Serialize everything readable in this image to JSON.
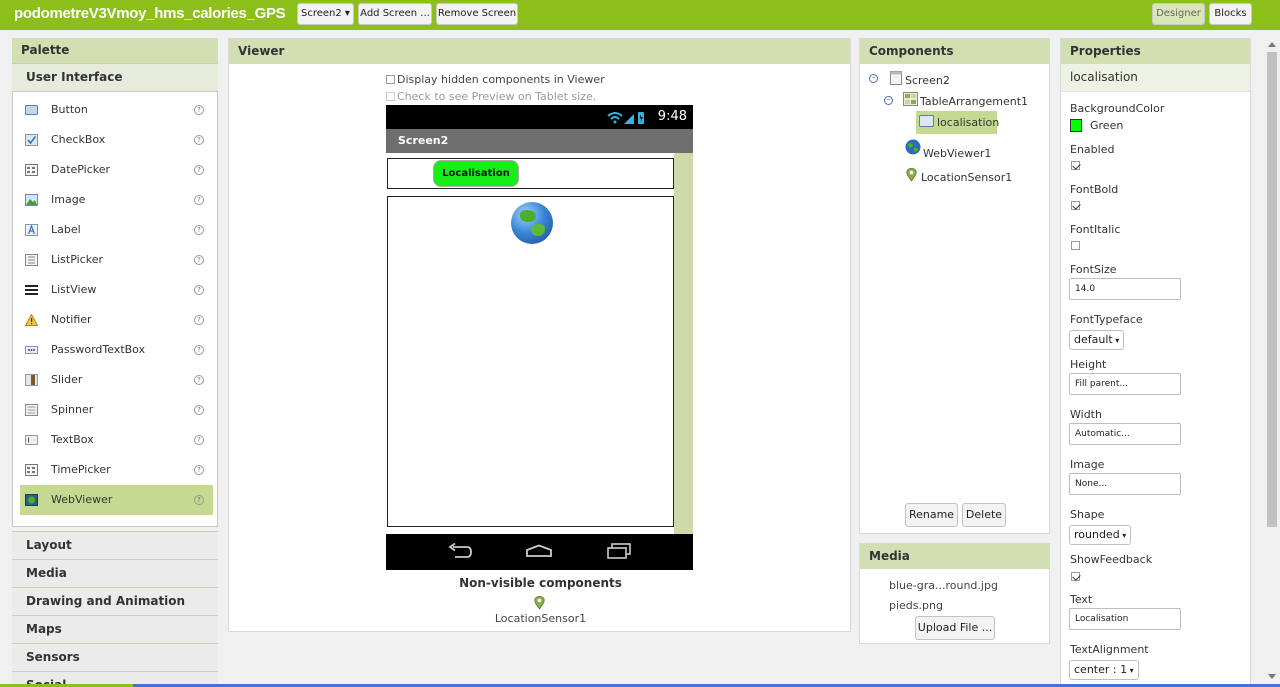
{
  "topbar": {
    "project_title": "podometreV3Vmoy_hms_calories_GPS",
    "screen_select": "Screen2 ▾",
    "add_screen": "Add Screen ...",
    "remove_screen": "Remove Screen",
    "designer": "Designer",
    "blocks": "Blocks"
  },
  "palette": {
    "title": "Palette",
    "open_category": "User Interface",
    "items": [
      {
        "label": "Button",
        "icon": "button-icon"
      },
      {
        "label": "CheckBox",
        "icon": "checkbox-icon"
      },
      {
        "label": "DatePicker",
        "icon": "datepicker-icon"
      },
      {
        "label": "Image",
        "icon": "image-icon"
      },
      {
        "label": "Label",
        "icon": "label-icon"
      },
      {
        "label": "ListPicker",
        "icon": "listpicker-icon"
      },
      {
        "label": "ListView",
        "icon": "listview-icon"
      },
      {
        "label": "Notifier",
        "icon": "notifier-icon"
      },
      {
        "label": "PasswordTextBox",
        "icon": "password-icon"
      },
      {
        "label": "Slider",
        "icon": "slider-icon"
      },
      {
        "label": "Spinner",
        "icon": "spinner-icon"
      },
      {
        "label": "TextBox",
        "icon": "textbox-icon"
      },
      {
        "label": "TimePicker",
        "icon": "timepicker-icon"
      },
      {
        "label": "WebViewer",
        "icon": "webviewer-icon"
      }
    ],
    "help_glyph": "?",
    "categories": [
      "Layout",
      "Media",
      "Drawing and Animation",
      "Maps",
      "Sensors",
      "Social"
    ]
  },
  "viewer": {
    "title": "Viewer",
    "hidden_components_label": "Display hidden components in Viewer",
    "tablet_label": "Check to see Preview on Tablet size.",
    "status_time": "9:48",
    "screen_title": "Screen2",
    "button_text": "Localisation",
    "nonvisible_label": "Non-visible components",
    "nonvisible_item": "LocationSensor1"
  },
  "components": {
    "title": "Components",
    "tree": {
      "screen": "Screen2",
      "arrangement": "TableArrangement1",
      "button": "localisation",
      "webviewer": "WebViewer1",
      "sensor": "LocationSensor1"
    },
    "rename": "Rename",
    "delete": "Delete"
  },
  "media": {
    "title": "Media",
    "files": [
      "blue-gra...round.jpg",
      "pieds.png"
    ],
    "upload": "Upload File ..."
  },
  "properties": {
    "title": "Properties",
    "component": "localisation",
    "background_color_label": "BackgroundColor",
    "background_color_value": "Green",
    "background_color_hex": "#00ff00",
    "enabled_label": "Enabled",
    "enabled": true,
    "fontbold_label": "FontBold",
    "fontbold": true,
    "fontitalic_label": "FontItalic",
    "fontitalic": false,
    "fontsize_label": "FontSize",
    "fontsize_value": "14.0",
    "fonttypeface_label": "FontTypeface",
    "fonttypeface_value": "default",
    "height_label": "Height",
    "height_value": "Fill parent...",
    "width_label": "Width",
    "width_value": "Automatic...",
    "image_label": "Image",
    "image_value": "None...",
    "shape_label": "Shape",
    "shape_value": "rounded",
    "showfeedback_label": "ShowFeedback",
    "showfeedback": true,
    "text_label": "Text",
    "text_value": "Localisation",
    "textalignment_label": "TextAlignment",
    "textalignment_value": "center : 1"
  },
  "colors": {
    "topbar": "#8dbf1a",
    "panel_header": "#d2dfb3",
    "selection": "#c6d990",
    "button_green": "#17ee17"
  }
}
